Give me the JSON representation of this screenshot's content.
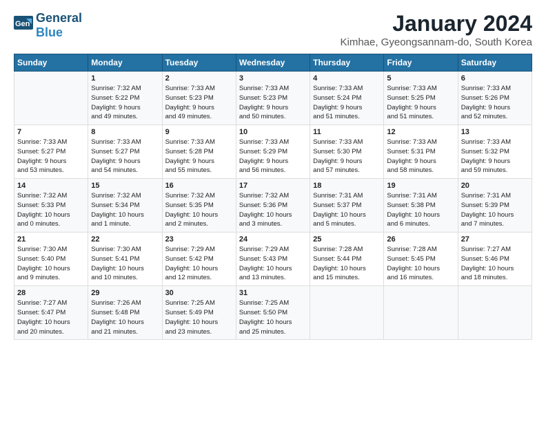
{
  "header": {
    "logo_general": "General",
    "logo_blue": "Blue",
    "title": "January 2024",
    "subtitle": "Kimhae, Gyeongsannam-do, South Korea"
  },
  "days_of_week": [
    "Sunday",
    "Monday",
    "Tuesday",
    "Wednesday",
    "Thursday",
    "Friday",
    "Saturday"
  ],
  "weeks": [
    [
      {
        "day": "",
        "text": ""
      },
      {
        "day": "1",
        "text": "Sunrise: 7:32 AM\nSunset: 5:22 PM\nDaylight: 9 hours\nand 49 minutes."
      },
      {
        "day": "2",
        "text": "Sunrise: 7:33 AM\nSunset: 5:23 PM\nDaylight: 9 hours\nand 49 minutes."
      },
      {
        "day": "3",
        "text": "Sunrise: 7:33 AM\nSunset: 5:23 PM\nDaylight: 9 hours\nand 50 minutes."
      },
      {
        "day": "4",
        "text": "Sunrise: 7:33 AM\nSunset: 5:24 PM\nDaylight: 9 hours\nand 51 minutes."
      },
      {
        "day": "5",
        "text": "Sunrise: 7:33 AM\nSunset: 5:25 PM\nDaylight: 9 hours\nand 51 minutes."
      },
      {
        "day": "6",
        "text": "Sunrise: 7:33 AM\nSunset: 5:26 PM\nDaylight: 9 hours\nand 52 minutes."
      }
    ],
    [
      {
        "day": "7",
        "text": "Sunrise: 7:33 AM\nSunset: 5:27 PM\nDaylight: 9 hours\nand 53 minutes."
      },
      {
        "day": "8",
        "text": "Sunrise: 7:33 AM\nSunset: 5:27 PM\nDaylight: 9 hours\nand 54 minutes."
      },
      {
        "day": "9",
        "text": "Sunrise: 7:33 AM\nSunset: 5:28 PM\nDaylight: 9 hours\nand 55 minutes."
      },
      {
        "day": "10",
        "text": "Sunrise: 7:33 AM\nSunset: 5:29 PM\nDaylight: 9 hours\nand 56 minutes."
      },
      {
        "day": "11",
        "text": "Sunrise: 7:33 AM\nSunset: 5:30 PM\nDaylight: 9 hours\nand 57 minutes."
      },
      {
        "day": "12",
        "text": "Sunrise: 7:33 AM\nSunset: 5:31 PM\nDaylight: 9 hours\nand 58 minutes."
      },
      {
        "day": "13",
        "text": "Sunrise: 7:33 AM\nSunset: 5:32 PM\nDaylight: 9 hours\nand 59 minutes."
      }
    ],
    [
      {
        "day": "14",
        "text": "Sunrise: 7:32 AM\nSunset: 5:33 PM\nDaylight: 10 hours\nand 0 minutes."
      },
      {
        "day": "15",
        "text": "Sunrise: 7:32 AM\nSunset: 5:34 PM\nDaylight: 10 hours\nand 1 minute."
      },
      {
        "day": "16",
        "text": "Sunrise: 7:32 AM\nSunset: 5:35 PM\nDaylight: 10 hours\nand 2 minutes."
      },
      {
        "day": "17",
        "text": "Sunrise: 7:32 AM\nSunset: 5:36 PM\nDaylight: 10 hours\nand 3 minutes."
      },
      {
        "day": "18",
        "text": "Sunrise: 7:31 AM\nSunset: 5:37 PM\nDaylight: 10 hours\nand 5 minutes."
      },
      {
        "day": "19",
        "text": "Sunrise: 7:31 AM\nSunset: 5:38 PM\nDaylight: 10 hours\nand 6 minutes."
      },
      {
        "day": "20",
        "text": "Sunrise: 7:31 AM\nSunset: 5:39 PM\nDaylight: 10 hours\nand 7 minutes."
      }
    ],
    [
      {
        "day": "21",
        "text": "Sunrise: 7:30 AM\nSunset: 5:40 PM\nDaylight: 10 hours\nand 9 minutes."
      },
      {
        "day": "22",
        "text": "Sunrise: 7:30 AM\nSunset: 5:41 PM\nDaylight: 10 hours\nand 10 minutes."
      },
      {
        "day": "23",
        "text": "Sunrise: 7:29 AM\nSunset: 5:42 PM\nDaylight: 10 hours\nand 12 minutes."
      },
      {
        "day": "24",
        "text": "Sunrise: 7:29 AM\nSunset: 5:43 PM\nDaylight: 10 hours\nand 13 minutes."
      },
      {
        "day": "25",
        "text": "Sunrise: 7:28 AM\nSunset: 5:44 PM\nDaylight: 10 hours\nand 15 minutes."
      },
      {
        "day": "26",
        "text": "Sunrise: 7:28 AM\nSunset: 5:45 PM\nDaylight: 10 hours\nand 16 minutes."
      },
      {
        "day": "27",
        "text": "Sunrise: 7:27 AM\nSunset: 5:46 PM\nDaylight: 10 hours\nand 18 minutes."
      }
    ],
    [
      {
        "day": "28",
        "text": "Sunrise: 7:27 AM\nSunset: 5:47 PM\nDaylight: 10 hours\nand 20 minutes."
      },
      {
        "day": "29",
        "text": "Sunrise: 7:26 AM\nSunset: 5:48 PM\nDaylight: 10 hours\nand 21 minutes."
      },
      {
        "day": "30",
        "text": "Sunrise: 7:25 AM\nSunset: 5:49 PM\nDaylight: 10 hours\nand 23 minutes."
      },
      {
        "day": "31",
        "text": "Sunrise: 7:25 AM\nSunset: 5:50 PM\nDaylight: 10 hours\nand 25 minutes."
      },
      {
        "day": "",
        "text": ""
      },
      {
        "day": "",
        "text": ""
      },
      {
        "day": "",
        "text": ""
      }
    ]
  ]
}
